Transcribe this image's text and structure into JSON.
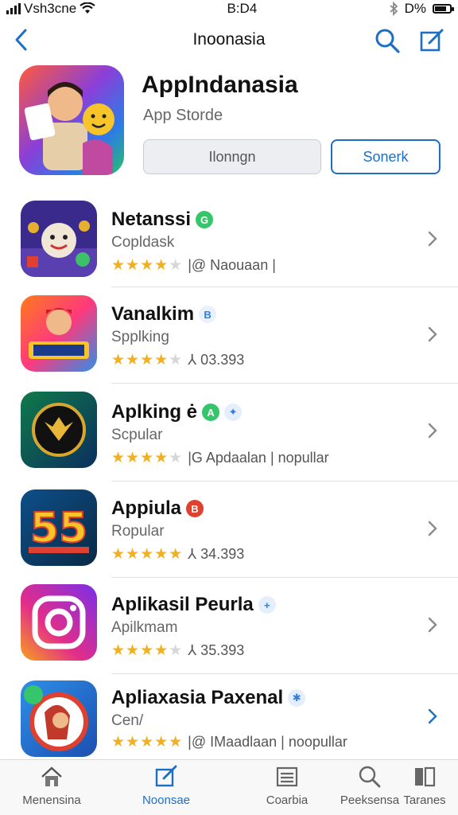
{
  "status_bar": {
    "carrier": "Vsh3cne",
    "time": "B:D4",
    "battery": "D%"
  },
  "nav": {
    "title": "Inoonasia"
  },
  "hero": {
    "title": "AppIndanasia",
    "subtitle": "App Storde",
    "primary_button": "Ilonngn",
    "secondary_button": "Sonerk"
  },
  "apps": [
    {
      "name": "Netanssi",
      "badge": "G",
      "badge_color": "#35c66b",
      "subtitle": "Copldask",
      "stars": 4,
      "meta": "|@ Naouaan |"
    },
    {
      "name": "Vanalkim",
      "badge": "B",
      "badge_color": "#2f7de1",
      "subtitle": "Spplking",
      "stars": 4,
      "meta": "⅄ 03.393"
    },
    {
      "name": "Aplking ė",
      "badge": "A",
      "badge_color": "#35c66b",
      "badge2": "✦",
      "badge2_color": "#2f7de1",
      "subtitle": "Scpular",
      "stars": 4,
      "meta": "|G Apdaalan | nopullar"
    },
    {
      "name": "Appiula",
      "badge": "B",
      "badge_color": "#e0402f",
      "subtitle": "Ropular",
      "stars": 5,
      "meta": "⅄ 34.393"
    },
    {
      "name": "Aplikasil Peurla",
      "badge": "+",
      "badge_color": "#2f7de1",
      "subtitle": "Apilkmam",
      "stars": 4,
      "meta": "⅄ 35.393"
    },
    {
      "name": "Apliaxasia Paxenal",
      "badge": "✱",
      "badge_color": "#2f7de1",
      "subtitle": "Cen/",
      "stars": 5,
      "meta": "|@ IMaadlaan | noopullar"
    }
  ],
  "tabs": [
    {
      "label": "Menensina",
      "icon": "home-icon"
    },
    {
      "label": "Noonsae",
      "icon": "edit-icon",
      "active": true
    },
    {
      "label": "Coarbia",
      "icon": "list-icon"
    },
    {
      "label": "Peeksensa",
      "icon": "search-icon"
    },
    {
      "label": "Taranes",
      "icon": "apps-icon"
    }
  ],
  "colors": {
    "accent": "#1d6fc4",
    "star": "#f2b01e"
  }
}
